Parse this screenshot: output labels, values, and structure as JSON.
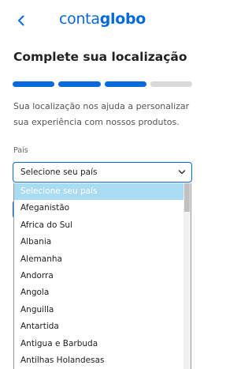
{
  "header": {
    "back_icon": "chevron-left-icon",
    "logo_part1": "conta",
    "logo_part2": "globo"
  },
  "page": {
    "title": "Complete sua localização",
    "description": "Sua localização nos ajuda a personalizar sua experiência com nossos produtos."
  },
  "progress": {
    "total_steps": 4,
    "completed_steps": 3,
    "active_color": "#0669de",
    "inactive_color": "#d9d9d9"
  },
  "country_field": {
    "label": "País",
    "value": "Selecione seu país",
    "icon": "chevron-down-icon"
  },
  "dropdown": {
    "options": [
      "Selecione seu país",
      "Afeganistão",
      "Africa do Sul",
      "Albania",
      "Alemanha",
      "Andorra",
      "Angola",
      "Anguilla",
      "Antartida",
      "Antigua e Barbuda",
      "Antilhas Holandesas"
    ],
    "selected_index": 0,
    "highlight_color": "#a9dbf2"
  }
}
